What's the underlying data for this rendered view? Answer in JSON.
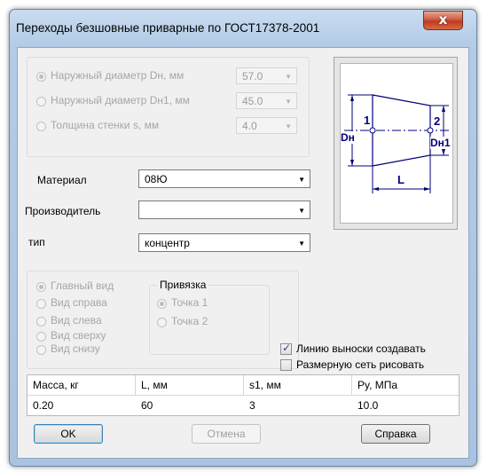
{
  "window": {
    "title": "Переходы безшовные приварные по ГОСТ17378-2001",
    "close_symbol": "x"
  },
  "dimensions": {
    "items": [
      {
        "label": "Наружный диаметр Dн, мм",
        "value": "57.0",
        "selected": true
      },
      {
        "label": "Наружный диаметр Dн1, мм",
        "value": "45.0",
        "selected": false
      },
      {
        "label": "Толщина стенки s, мм",
        "value": "4.0",
        "selected": false
      }
    ]
  },
  "preview": {
    "label_1": "1",
    "label_2": "2",
    "label_dn": "Dн",
    "label_dn1": "Dн1",
    "label_l": "L"
  },
  "material": {
    "label": "Материал",
    "value": "08Ю"
  },
  "manufacturer": {
    "label": "Производитель",
    "value": ""
  },
  "type": {
    "label": "тип",
    "value": "концентр"
  },
  "views": {
    "items": [
      {
        "label": "Главный вид",
        "selected": true
      },
      {
        "label": "Вид справа",
        "selected": false
      },
      {
        "label": "Вид слева",
        "selected": false
      },
      {
        "label": "Вид сверху",
        "selected": false
      },
      {
        "label": "Вид снизу",
        "selected": false
      }
    ]
  },
  "anchor": {
    "title": "Привязка",
    "point1": "Точка 1",
    "point2": "Точка 2"
  },
  "options": {
    "leader_label": "Линию выноски создавать",
    "leader_checked": true,
    "dimgrid_label": "Размерную сеть рисовать",
    "dimgrid_checked": false
  },
  "table": {
    "headers": [
      "Масса, кг",
      "L, мм",
      "s1, мм",
      "Py, МПа"
    ],
    "row": [
      "0.20",
      "60",
      "3",
      "10.0"
    ]
  },
  "buttons": {
    "ok": "OK",
    "cancel": "Отмена",
    "help": "Справка"
  }
}
